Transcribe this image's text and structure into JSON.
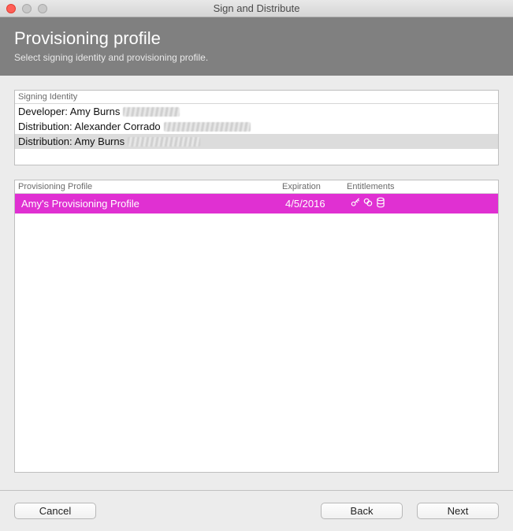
{
  "window": {
    "title": "Sign and Distribute"
  },
  "header": {
    "title": "Provisioning profile",
    "subtitle": "Select signing identity and provisioning profile."
  },
  "signing": {
    "header": "Signing Identity",
    "rows": [
      {
        "label": "Developer: Amy Burns"
      },
      {
        "label": "Distribution: Alexander Corrado"
      },
      {
        "label": "Distribution: Amy Burns"
      }
    ],
    "selected_index": 2
  },
  "profiles": {
    "columns": {
      "name": "Provisioning Profile",
      "expiration": "Expiration",
      "entitlements": "Entitlements"
    },
    "rows": [
      {
        "name": "Amy's Provisioning Profile",
        "expiration": "4/5/2016"
      }
    ],
    "selected_index": 0
  },
  "buttons": {
    "cancel": "Cancel",
    "back": "Back",
    "next": "Next"
  }
}
